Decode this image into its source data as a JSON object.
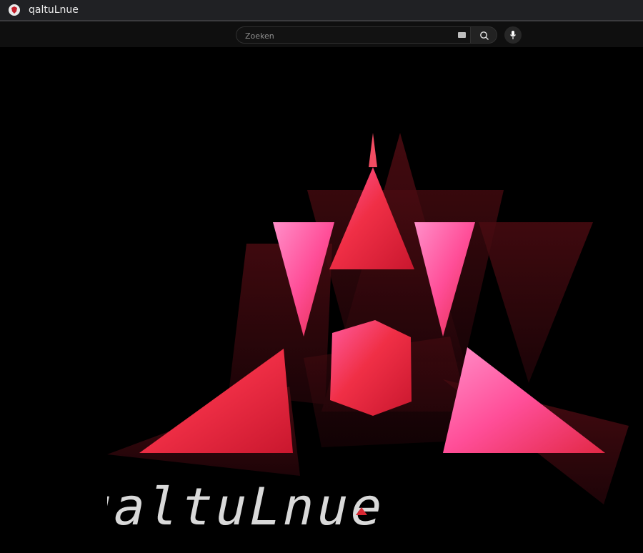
{
  "window": {
    "title": "qaltuLnue"
  },
  "search": {
    "placeholder": "Zoeken",
    "value": ""
  },
  "icons": {
    "favicon": "shield-icon",
    "keyboard": "keyboard-icon",
    "search": "search-icon",
    "mic": "mic-icon"
  },
  "colors": {
    "titlebar": "#202124",
    "topbar": "#0f0f0f",
    "art_red": "#e02a3b",
    "art_pink": "#ff5ea5",
    "art_dark": "#5a0d12",
    "wordmark": "#d9d9d9"
  }
}
